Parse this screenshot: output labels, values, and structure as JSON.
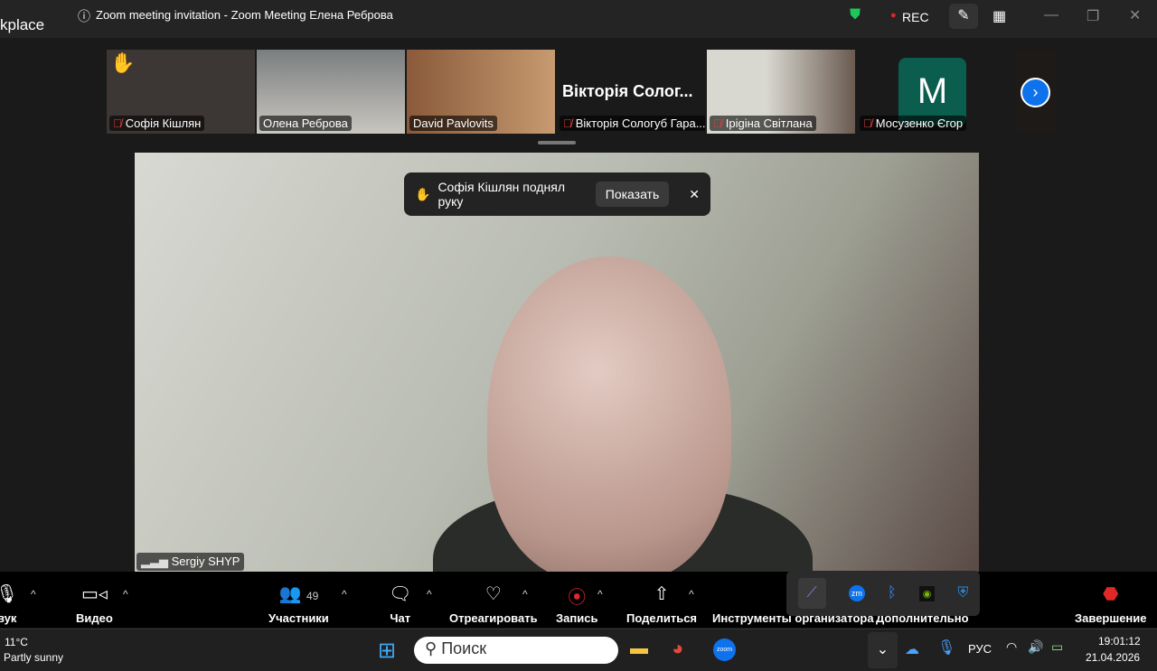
{
  "titlebar": {
    "left_text": "kplace",
    "title": "Zoom meeting invitation - Zoom Meeting Елена Реброва",
    "rec": "REC"
  },
  "participants": [
    {
      "name": "Софія Кішлян",
      "muted": true,
      "hand": "✋"
    },
    {
      "name": "Олена Реброва",
      "muted": false
    },
    {
      "name": "David Pavlovits",
      "muted": false
    },
    {
      "name": "Вікторія Сологуб Гара...",
      "muted": true,
      "big": "Вікторія  Солог..."
    },
    {
      "name": "Ірigіна  Світлана",
      "muted": true
    },
    {
      "name": "Мосузенко Єгор",
      "muted": true,
      "avatar": "M"
    }
  ],
  "notification": {
    "text": "Софія Кішлян поднял руку",
    "button": "Показать"
  },
  "speaker": {
    "name": "Sergiy SHYP"
  },
  "toolbar": {
    "audio": "вук",
    "video": "Видео",
    "participants": "Участники",
    "participants_count": "49",
    "chat": "Чат",
    "react": "Отреагировать",
    "record": "Запись",
    "share": "Поделиться",
    "host_tools": "Инструменты организатора",
    "more": "Дополнительно",
    "end": "Завершение"
  },
  "taskbar": {
    "temp": "11°C",
    "weather": "Partly sunny",
    "search": "Поиск",
    "lang": "РУС",
    "time": "19:01:12",
    "date": "21.04.2026"
  },
  "colors": {
    "accent": "#0e72ed",
    "end": "#e02828",
    "avatar": "#0b5d4e"
  }
}
